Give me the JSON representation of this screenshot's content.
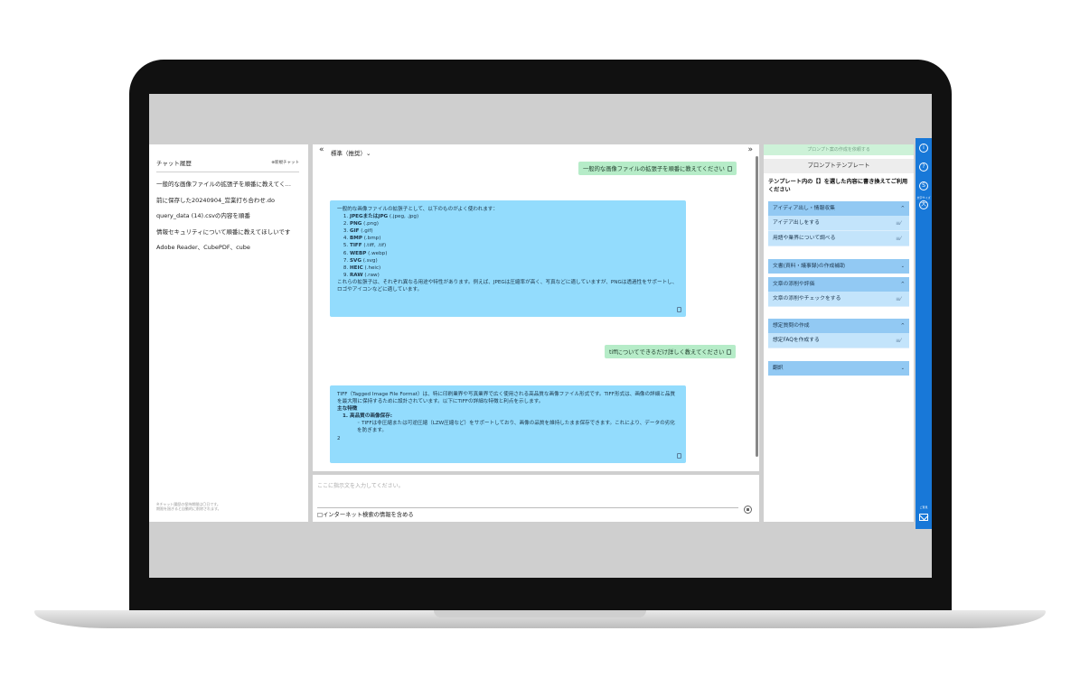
{
  "history": {
    "title": "チャット履歴",
    "new_chat": "⊕新規チャット",
    "items": [
      "一般的な画像ファイルの拡張子を順番に教えてく…",
      "前に保存した20240904_営業打ち合わせ.do",
      "query_data (14).csvの内容を順番",
      "情報セキュリティについて順番に教えてほしいです",
      "Adobe Reader、CubePDF、cube"
    ],
    "note_1": "※チャット履歴の保持期間は〇日です。",
    "note_2": "期限を過ぎると自動的に削除されます。"
  },
  "chat": {
    "collapse_left": "«",
    "collapse_right": "»",
    "model": "標準（推奨）⌄",
    "msg1_user": "一般的な画像ファイルの拡張子を順番に教えてください",
    "msg1_intro": "一般的な画像ファイルの拡張子として、以下のものがよく使われます：",
    "msg1_items": [
      {
        "b": "JPEGまたはJPG",
        "t": " (.jpeg, .jpg)"
      },
      {
        "b": "PNG",
        "t": " (.png)"
      },
      {
        "b": "GIF",
        "t": " (.gif)"
      },
      {
        "b": "BMP",
        "t": " (.bmp)"
      },
      {
        "b": "TIFF",
        "t": " (.tiff, .tif)"
      },
      {
        "b": "WEBP",
        "t": " (.webp)"
      },
      {
        "b": "SVG",
        "t": " (.svg)"
      },
      {
        "b": "HEIC",
        "t": " (.heic)"
      },
      {
        "b": "RAW",
        "t": " (.raw)"
      }
    ],
    "msg1_outro": "これらの拡張子は、それぞれ異なる用途や特性があります。例えば、JPEGは圧縮率が高く、写真などに適していますが、PNGは透過性をサポートし、ロゴやアイコンなどに適しています。",
    "msg2_user": "tiffについてできるだけ詳しく教えてください",
    "msg2_intro": "TIFF（Tagged Image File Format）は、特に印刷業界や写真業界で広く使用される高品質な画像ファイル形式です。TIFF形式は、画像の詳細と品質を最大限に保持するために設計されています。以下にTIFFの詳細な特徴と利点を示します。",
    "msg2_heading": "主な特徴",
    "msg2_sub": "高品質の画像保存:",
    "msg2_bullet": "TIFFは非圧縮または可逆圧縮（LZW圧縮など）をサポートしており、画像の品質を維持したまま保存できます。これにより、データの劣化を防ぎます。",
    "msg2_tail": "2",
    "input_placeholder": "ここに指示文を入力してください。",
    "web_search": "□インターネット検索の情報を含める"
  },
  "templates": {
    "create_button": "プロンプト案の作成を依頼する",
    "title": "プロンプトテンプレート",
    "description": "テンプレート内の【】を選した内容に書き換えてご利用ください",
    "groups": [
      {
        "label": "アイディア出し・情報収集",
        "chev": "^",
        "items": [
          "アイデア出しをする",
          "用語や業界について調べる"
        ]
      },
      {
        "label": "文書(資料・議事録)の作成補助",
        "chev": "⌄",
        "items": []
      },
      {
        "label": "文章の添削や評価",
        "chev": "^",
        "items": [
          "文章の添削やチェックをする"
        ]
      },
      {
        "label": "想定質問の作成",
        "chev": "^",
        "items": [
          "想定FAQを作成する"
        ]
      },
      {
        "label": "翻訳",
        "chev": "⌄",
        "items": []
      }
    ],
    "item_icon": "≡⁄"
  },
  "rail": {
    "info_icon": "i",
    "help_icon": "?",
    "settings_icon": "S",
    "small_label": "文字サイズ",
    "big_icon": "大",
    "feedback": "ご意見"
  },
  "icons": [
    "info-icon",
    "help-icon",
    "settings-icon",
    "font-size-icon",
    "mail-icon",
    "copy-icon",
    "send-icon"
  ],
  "colors": {
    "user_bubble": "#b6ecc8",
    "ai_bubble": "#93dcfd",
    "accent": "#1878d8"
  }
}
